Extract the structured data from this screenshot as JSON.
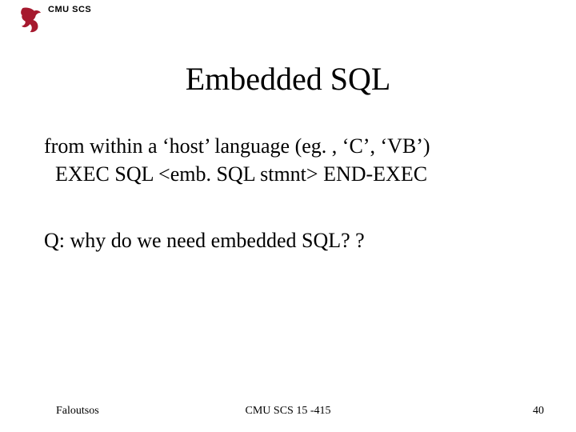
{
  "header": {
    "org": "CMU SCS"
  },
  "slide": {
    "title": "Embedded SQL",
    "line1": "from within a ‘host’ language (eg. , ‘C’, ‘VB’)",
    "line2": "EXEC SQL <emb. SQL stmnt> END-EXEC",
    "question": "Q: why do we need embedded SQL? ?"
  },
  "footer": {
    "author": "Faloutsos",
    "course": "CMU SCS 15 -415",
    "page": "40"
  }
}
